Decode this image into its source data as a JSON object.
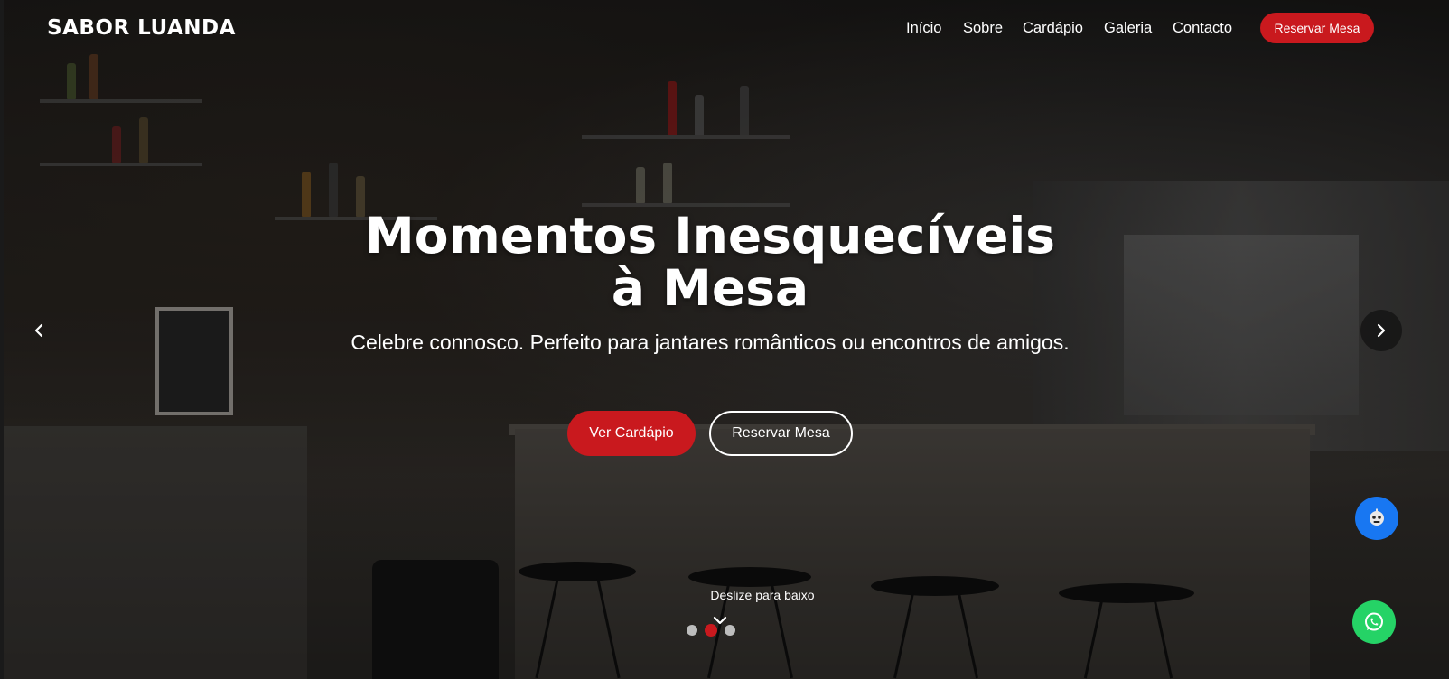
{
  "brand": {
    "logo": "SABOR LUANDA"
  },
  "nav": {
    "items": [
      {
        "label": "Início"
      },
      {
        "label": "Sobre"
      },
      {
        "label": "Cardápio"
      },
      {
        "label": "Galeria"
      },
      {
        "label": "Contacto"
      }
    ],
    "cta": "Reservar Mesa"
  },
  "hero": {
    "title": "Momentos Inesquecíveis à Mesa",
    "subtitle": "Celebre connosco. Perfeito para jantares românticos ou encontros de amigos.",
    "primary_button": "Ver Cardápio",
    "secondary_button": "Reservar Mesa",
    "scroll_hint": "Deslize para baixo"
  },
  "carousel": {
    "slide_count": 3,
    "active_slide": 2
  },
  "icons": {
    "prev": "chevron-left-icon",
    "next": "chevron-right-icon",
    "scroll": "chevron-down-icon",
    "chatbot": "chatbot-icon",
    "whatsapp": "whatsapp-icon"
  },
  "colors": {
    "accent": "#c9191e",
    "chatbot": "#1877f2",
    "whatsapp": "#25d366"
  }
}
